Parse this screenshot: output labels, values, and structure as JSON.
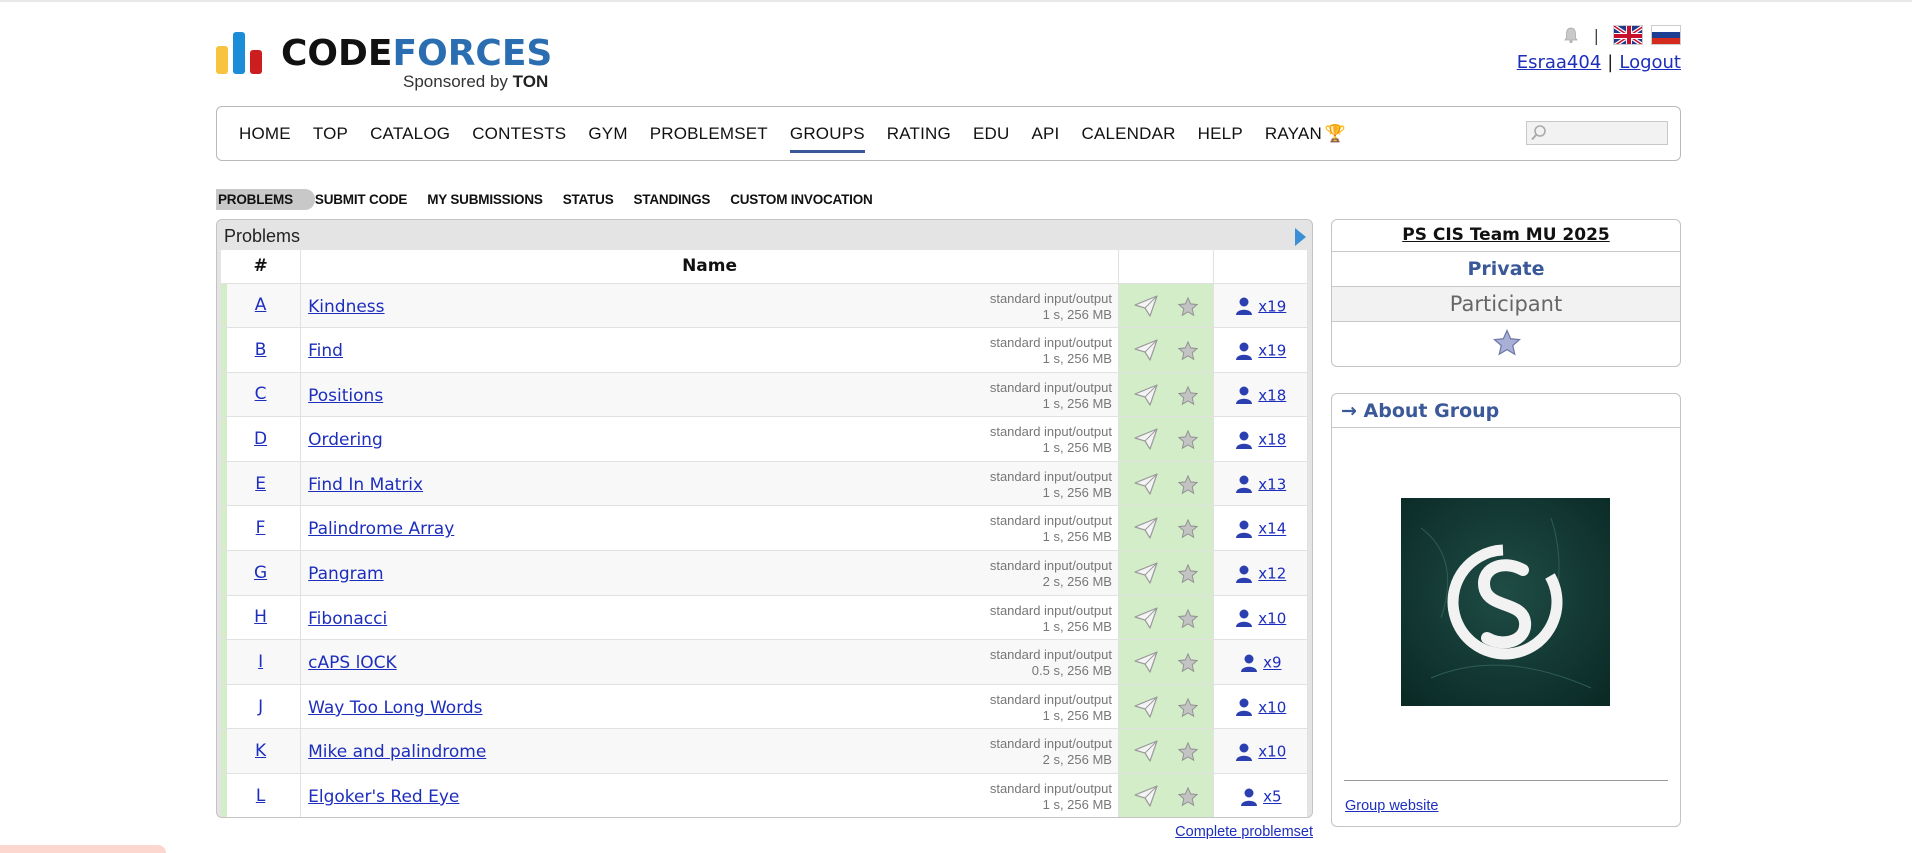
{
  "logo": {
    "code": "CODE",
    "forces": "FORCES",
    "sponsor_prefix": "Sponsored by",
    "sponsor_brand": "TON"
  },
  "header": {
    "separator": "|",
    "username": "Esraa404",
    "user_separator": "|",
    "logout": "Logout"
  },
  "menu": {
    "items": [
      "HOME",
      "TOP",
      "CATALOG",
      "CONTESTS",
      "GYM",
      "PROBLEMSET",
      "GROUPS",
      "RATING",
      "EDU",
      "API",
      "CALENDAR",
      "HELP",
      "RAYAN"
    ],
    "active": "GROUPS"
  },
  "submenu": {
    "items": [
      "PROBLEMS",
      "SUBMIT CODE",
      "MY SUBMISSIONS",
      "STATUS",
      "STANDINGS",
      "CUSTOM INVOCATION"
    ],
    "active": "PROBLEMS"
  },
  "problems": {
    "title": "Problems",
    "columns": {
      "index": "#",
      "name": "Name"
    },
    "rows": [
      {
        "idx": "A",
        "name": "Kindness",
        "io": "standard input/output",
        "limits": "1 s, 256 MB",
        "solved": "x19"
      },
      {
        "idx": "B",
        "name": "Find",
        "io": "standard input/output",
        "limits": "1 s, 256 MB",
        "solved": "x19"
      },
      {
        "idx": "C",
        "name": "Positions",
        "io": "standard input/output",
        "limits": "1 s, 256 MB",
        "solved": "x18"
      },
      {
        "idx": "D",
        "name": "Ordering",
        "io": "standard input/output",
        "limits": "1 s, 256 MB",
        "solved": "x18"
      },
      {
        "idx": "E",
        "name": "Find In Matrix",
        "io": "standard input/output",
        "limits": "1 s, 256 MB",
        "solved": "x13"
      },
      {
        "idx": "F",
        "name": "Palindrome Array",
        "io": "standard input/output",
        "limits": "1 s, 256 MB",
        "solved": "x14"
      },
      {
        "idx": "G",
        "name": "Pangram",
        "io": "standard input/output",
        "limits": "2 s, 256 MB",
        "solved": "x12"
      },
      {
        "idx": "H",
        "name": "Fibonacci",
        "io": "standard input/output",
        "limits": "1 s, 256 MB",
        "solved": "x10"
      },
      {
        "idx": "I",
        "name": "cAPS lOCK",
        "io": "standard input/output",
        "limits": "0.5 s, 256 MB",
        "solved": "x9"
      },
      {
        "idx": "J",
        "name": "Way Too Long Words",
        "io": "standard input/output",
        "limits": "1 s, 256 MB",
        "solved": "x10"
      },
      {
        "idx": "K",
        "name": "Mike and palindrome",
        "io": "standard input/output",
        "limits": "2 s, 256 MB",
        "solved": "x10"
      },
      {
        "idx": "L",
        "name": "Elgoker's Red Eye",
        "io": "standard input/output",
        "limits": "1 s, 256 MB",
        "solved": "x5"
      }
    ],
    "complete_link": "Complete problemset"
  },
  "group_box": {
    "name": "PS CIS Team MU 2025",
    "visibility": "Private",
    "role": "Participant"
  },
  "about_box": {
    "title": "→ About Group",
    "website_link": "Group website"
  },
  "colors": {
    "accent": "#3b5998",
    "link": "#1d2ebd",
    "accepted_bg": "#d4edc9"
  }
}
